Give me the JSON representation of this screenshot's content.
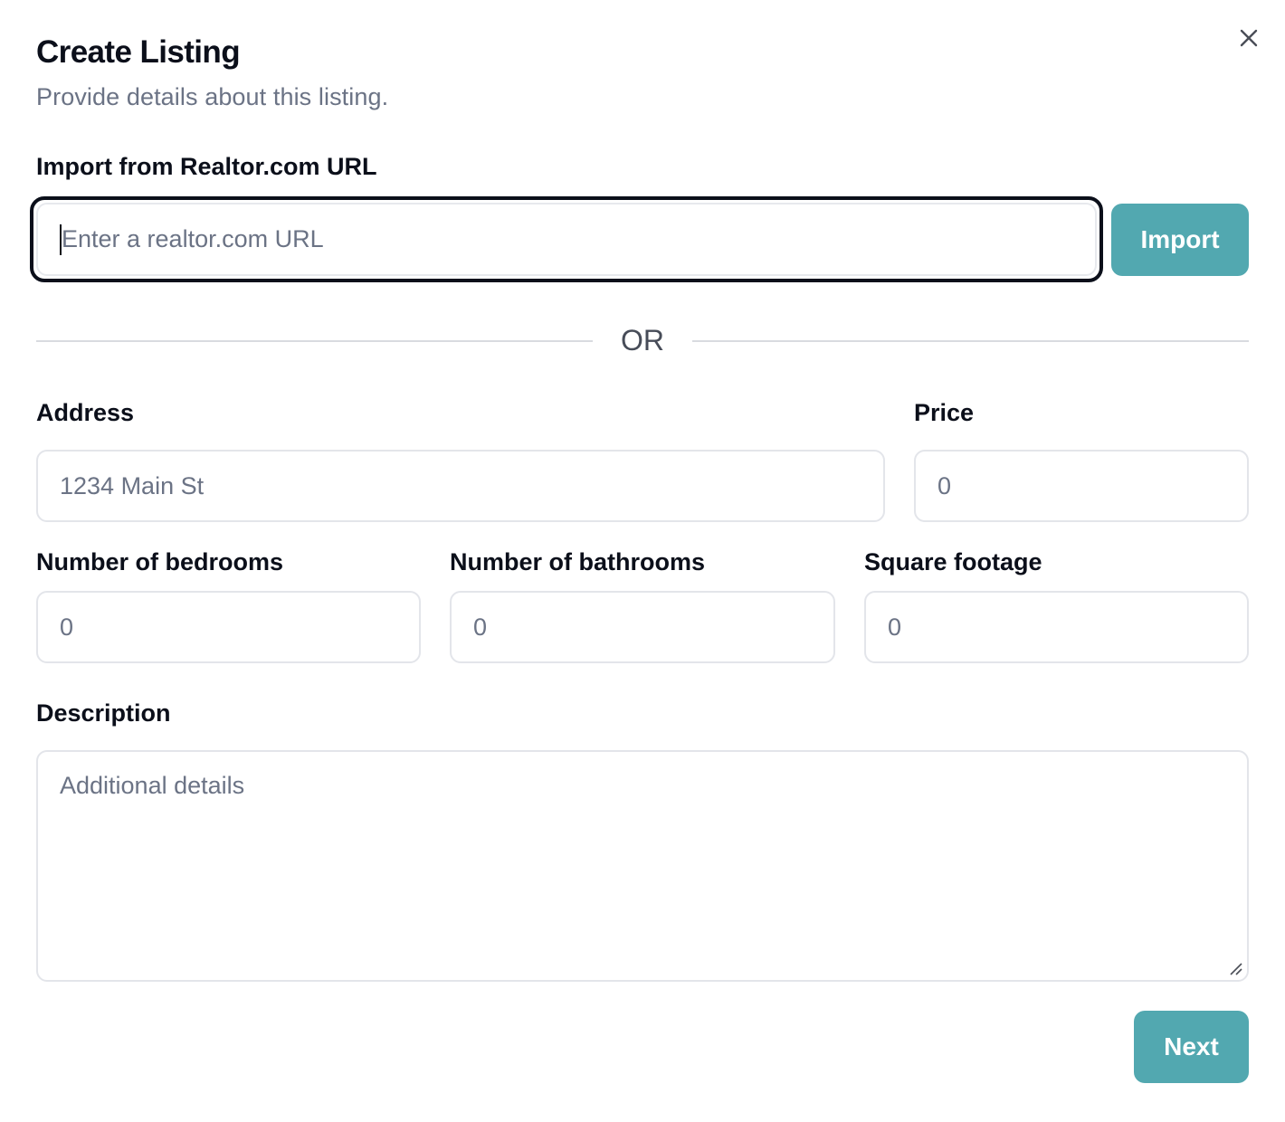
{
  "dialog": {
    "title": "Create Listing",
    "subtitle": "Provide details about this listing.",
    "close_icon": "close-icon"
  },
  "import": {
    "label": "Import from Realtor.com URL",
    "url_value": "",
    "url_placeholder": "Enter a realtor.com URL",
    "button_label": "Import"
  },
  "separator": {
    "text": "OR"
  },
  "form": {
    "address": {
      "label": "Address",
      "value": "",
      "placeholder": "1234 Main St"
    },
    "price": {
      "label": "Price",
      "value": "",
      "placeholder": "0"
    },
    "bedrooms": {
      "label": "Number of bedrooms",
      "value": "",
      "placeholder": "0"
    },
    "bathrooms": {
      "label": "Number of bathrooms",
      "value": "",
      "placeholder": "0"
    },
    "square_footage": {
      "label": "Square footage",
      "value": "",
      "placeholder": "0"
    },
    "description": {
      "label": "Description",
      "value": "",
      "placeholder": "Additional details"
    }
  },
  "footer": {
    "next_label": "Next"
  },
  "colors": {
    "accent": "#52a8b0",
    "text_primary": "#0b0f1a",
    "text_muted": "#6b7385",
    "border": "#e3e5ea",
    "focus_ring": "#0b0f1a"
  }
}
